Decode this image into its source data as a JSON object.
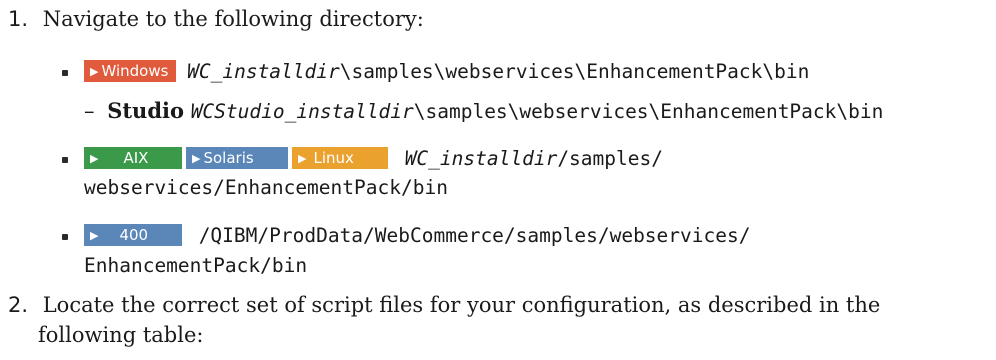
{
  "steps": [
    {
      "number": "1.",
      "text": "Navigate to the following directory:",
      "items": [
        {
          "tag": "Windows",
          "path_var": "WC_installdir",
          "path_rest": "\\samples\\webservices\\EnhancementPack\\bin",
          "subitem": {
            "dash": "–",
            "label": "Studio",
            "path_var": "WCStudio_installdir",
            "path_rest": "\\samples\\webservices\\EnhancementPack\\bin"
          }
        },
        {
          "tags": [
            "AIX",
            "Solaris",
            "Linux"
          ],
          "path_var": "WC_installdir",
          "path_rest_line1": "/samples/",
          "path_line2": "webservices/EnhancementPack/bin"
        },
        {
          "tag": "400",
          "path_line1": "/QIBM/ProdData/WebCommerce/samples/webservices/",
          "path_line2": "EnhancementPack/bin"
        }
      ]
    },
    {
      "number": "2.",
      "text_line1": "Locate the correct set of script files for your configuration, as described in the",
      "text_line2": "following table:"
    }
  ],
  "colors": {
    "windows": "#e05a3c",
    "aix": "#3a9a4a",
    "solaris": "#5a86b8",
    "linux": "#eaa12e",
    "i400": "#5a86b8"
  }
}
